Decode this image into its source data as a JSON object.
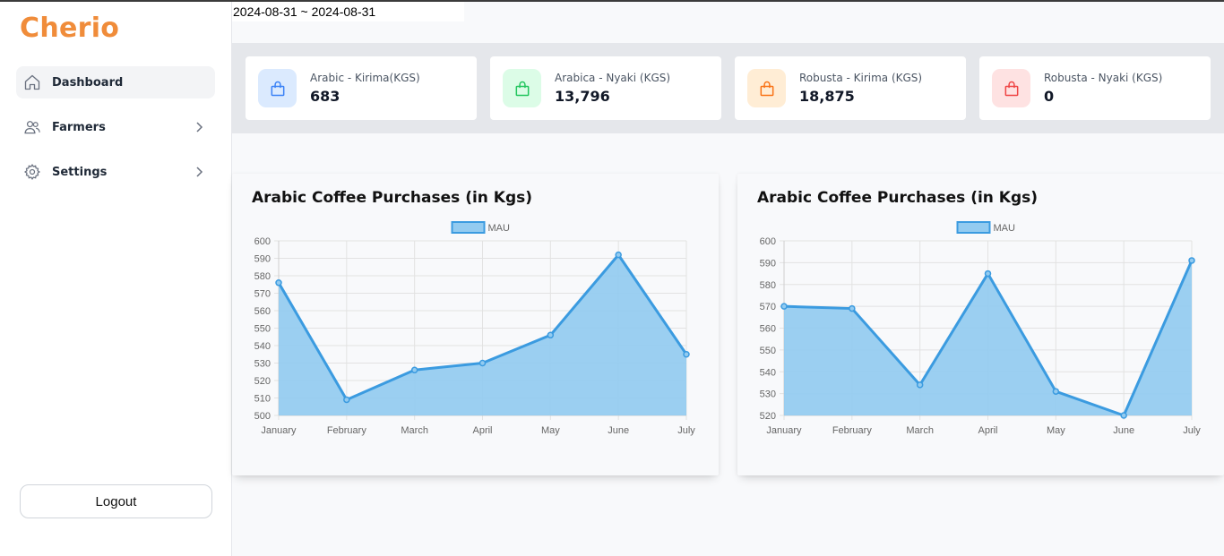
{
  "app": {
    "brand": "Cherio"
  },
  "date_range": "2024-08-31 ~ 2024-08-31",
  "sidebar": {
    "items": [
      {
        "label": "Dashboard",
        "icon": "home-icon",
        "active": true
      },
      {
        "label": "Farmers",
        "icon": "users-icon",
        "has_submenu": true
      },
      {
        "label": "Settings",
        "icon": "gear-icon",
        "has_submenu": true
      }
    ],
    "logout_label": "Logout"
  },
  "stats": [
    {
      "label": "Arabic - Kirima(KGS)",
      "value": "683",
      "icon": "shopping-bag-icon",
      "color": "#3b82f6",
      "bg": "#dbeafe"
    },
    {
      "label": "Arabica - Nyaki (KGS)",
      "value": "13,796",
      "icon": "shopping-bag-icon",
      "color": "#22c55e",
      "bg": "#dcfce7"
    },
    {
      "label": "Robusta - Kirima (KGS)",
      "value": "18,875",
      "icon": "shopping-bag-icon",
      "color": "#f97316",
      "bg": "#ffedd5"
    },
    {
      "label": "Robusta - Nyaki (KGS)",
      "value": "0",
      "icon": "shopping-bag-icon",
      "color": "#ef4444",
      "bg": "#fee2e2"
    }
  ],
  "chart_data": [
    {
      "type": "area",
      "title": "Arabic Coffee Purchases (in Kgs)",
      "legend_position": "top",
      "categories": [
        "January",
        "February",
        "March",
        "April",
        "May",
        "June",
        "July"
      ],
      "series": [
        {
          "name": "MAU",
          "values": [
            576,
            509,
            526,
            530,
            546,
            592,
            535
          ]
        }
      ],
      "ylim": [
        500,
        600
      ],
      "yticks": [
        500,
        510,
        520,
        530,
        540,
        550,
        560,
        570,
        580,
        590,
        600
      ],
      "grid": true,
      "color": "#3b9be0",
      "fill": "#93cbf0"
    },
    {
      "type": "area",
      "title": "Arabic Coffee Purchases (in Kgs)",
      "legend_position": "top",
      "categories": [
        "January",
        "February",
        "March",
        "April",
        "May",
        "June",
        "July"
      ],
      "series": [
        {
          "name": "MAU",
          "values": [
            570,
            569,
            534,
            585,
            531,
            520,
            591
          ]
        }
      ],
      "ylim": [
        520,
        600
      ],
      "yticks": [
        520,
        530,
        540,
        550,
        560,
        570,
        580,
        590,
        600
      ],
      "grid": true,
      "color": "#3b9be0",
      "fill": "#93cbf0"
    }
  ]
}
